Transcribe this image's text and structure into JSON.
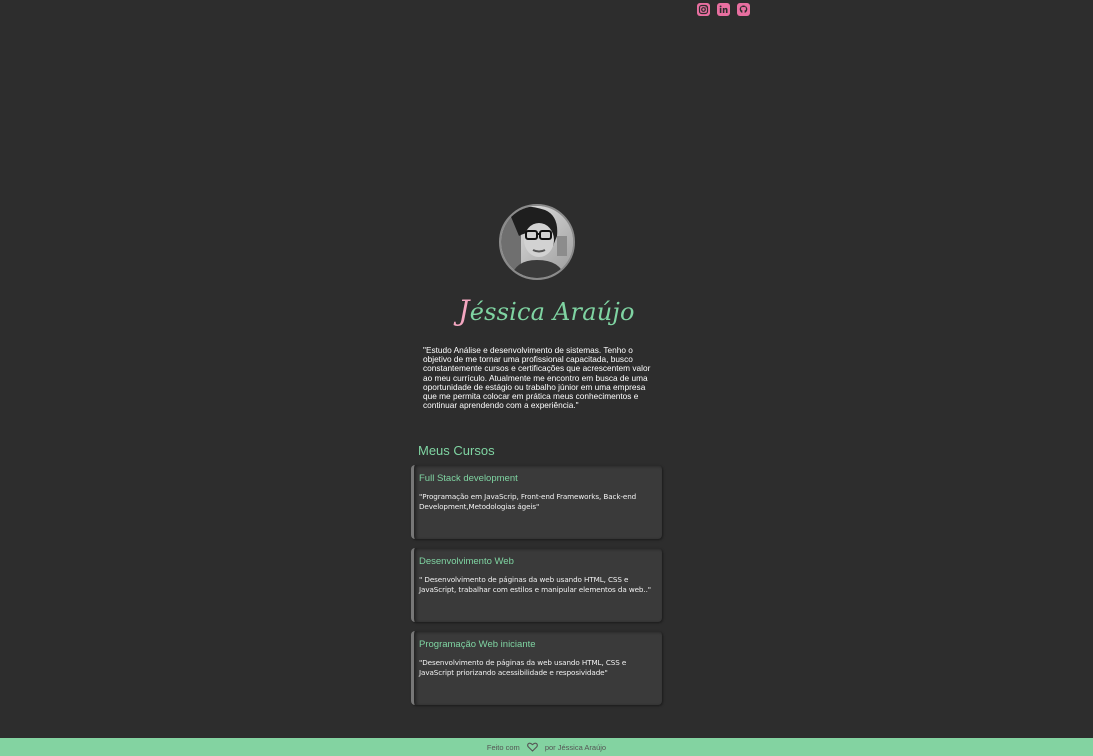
{
  "social": {
    "instagram_icon": "instagram-icon",
    "linkedin_icon": "linkedin-icon",
    "github_icon": "github-icon",
    "color": "#e86fa0"
  },
  "profile": {
    "name_initial": "J",
    "name_rest": "éssica Araújo",
    "bio": "\"Estudo Análise e desenvolvimento de sistemas. Tenho o objetivo de me tornar uma profissional capacitada, busco constantemente cursos e certificações que acrescentem valor ao meu currículo. Atualmente me encontro em busca de uma oportunidade de estágio ou trabalho júnior em uma empresa que me permita colocar em prática meus conhecimentos e continuar aprendendo com a experiência.\""
  },
  "courses": {
    "title": "Meus Cursos",
    "items": [
      {
        "title": "Full Stack development",
        "description": "\"Programação em JavaScrip, Front-end Frameworks, Back-end Development,Metodologias ágeis\""
      },
      {
        "title": "Desenvolvimento Web",
        "description": "\" Desenvolvimento de páginas da web usando HTML, CSS e JavaScript, trabalhar com estilos e manipular elementos da web..\""
      },
      {
        "title": "Programação Web iniciante",
        "description": "\"Desenvolvimento de páginas da web usando HTML, CSS e JavaScript priorizando acessibilidade e resposividade\""
      }
    ]
  },
  "footer": {
    "made_with": "Feito com",
    "heart_icon": "heart-icon",
    "by": "por Jéssica Araújo"
  },
  "colors": {
    "background": "#2d2d2d",
    "accent_green": "#7fd4a2",
    "accent_pink": "#f4a6c0",
    "footer_bg": "#83d3a1"
  }
}
